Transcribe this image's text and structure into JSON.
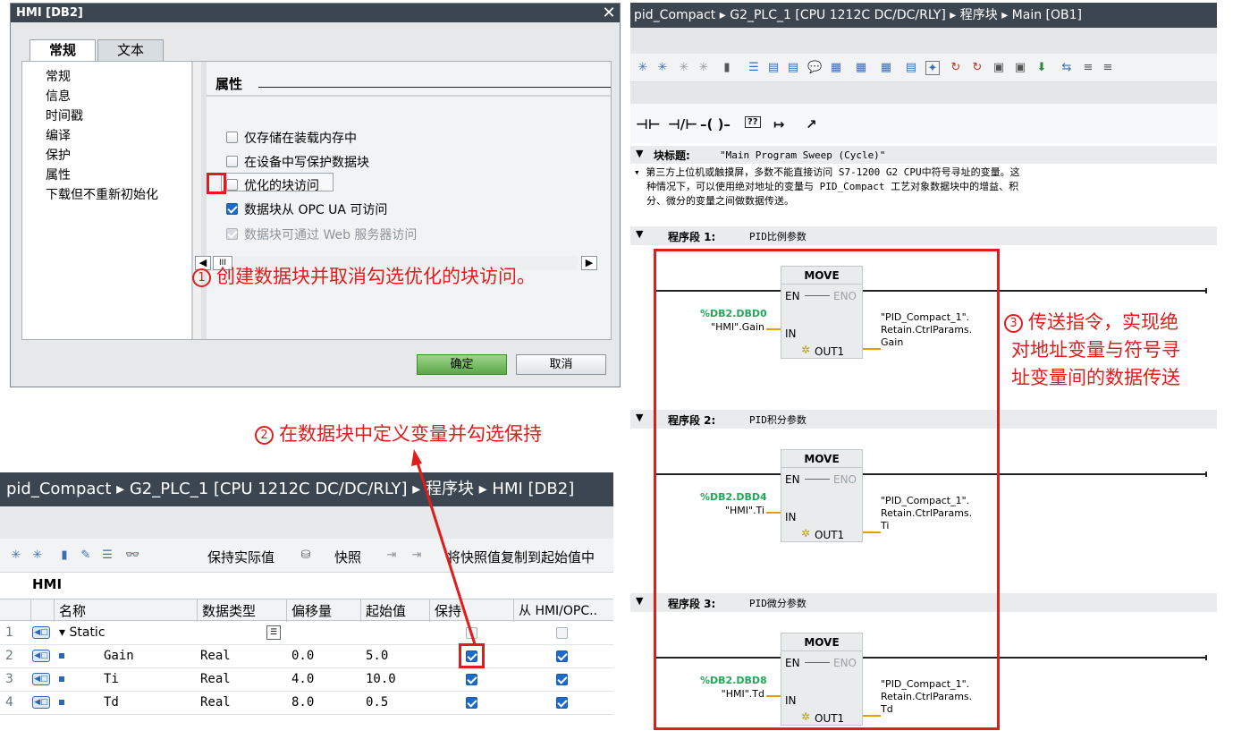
{
  "dialog": {
    "title": "HMI [DB2]",
    "close_glyph": "✕",
    "tabs": [
      "常规",
      "文本"
    ],
    "nav_items": [
      "常规",
      "信息",
      "时间戳",
      "编译",
      "保护",
      "属性",
      "下载但不重新初始化"
    ],
    "section_title": "属性",
    "options": [
      {
        "label": "仅存储在装载内存中",
        "checked": false,
        "enabled": true
      },
      {
        "label": "在设备中写保护数据块",
        "checked": false,
        "enabled": true
      },
      {
        "label": "优化的块访问",
        "checked": false,
        "enabled": true
      },
      {
        "label": "数据块从 OPC UA 可访问",
        "checked": true,
        "enabled": true
      },
      {
        "label": "数据块可通过 Web 服务器访问",
        "checked": true,
        "enabled": false
      }
    ],
    "scroll_thumb_glyph": "III",
    "ok_label": "确定",
    "cancel_label": "取消"
  },
  "annotations": {
    "note1_num": "1",
    "note1": "创建数据块并取消勾选优化的块访问。",
    "note2_num": "2",
    "note2": "在数据块中定义变量并勾选保持",
    "note3_num": "3",
    "note3_lines": [
      "传送指令，实现绝",
      "对地址变量与符号寻",
      "址变量间的数据传送"
    ],
    "accent_color": "#e21b1b"
  },
  "db_table": {
    "breadcrumb": "pid_Compact ▸ G2_PLC_1 [CPU 1212C DC/DC/RLY] ▸ 程序块 ▸ HMI [DB2]",
    "toolbar": {
      "keep_actual": "保持实际值",
      "snapshot": "快照",
      "copy_snapshot": "将快照值复制到起始值中"
    },
    "block_name": "HMI",
    "columns": [
      "名称",
      "数据类型",
      "偏移量",
      "起始值",
      "保持",
      "从 HMI/OPC.."
    ],
    "rows": [
      {
        "num": "1",
        "name": "Static",
        "type": "",
        "offset": "",
        "start": "",
        "retain": false,
        "hmi": false,
        "is_group": true
      },
      {
        "num": "2",
        "name": "Gain",
        "type": "Real",
        "offset": "0.0",
        "start": "5.0",
        "retain": true,
        "hmi": true
      },
      {
        "num": "3",
        "name": "Ti",
        "type": "Real",
        "offset": "4.0",
        "start": "10.0",
        "retain": true,
        "hmi": true
      },
      {
        "num": "4",
        "name": "Td",
        "type": "Real",
        "offset": "8.0",
        "start": "0.5",
        "retain": true,
        "hmi": true
      }
    ]
  },
  "lad": {
    "breadcrumb": "pid_Compact ▸ G2_PLC_1 [CPU 1212C DC/DC/RLY] ▸ 程序块 ▸ Main [OB1]",
    "favorites": [
      "⊣⊢",
      "⊣/⊢",
      "–( )–",
      "??",
      "↦",
      "↗"
    ],
    "block_title_label": "块标题:",
    "block_title": "\"Main Program Sweep (Cycle)\"",
    "block_comment": [
      "第三方上位机或触摸屏，多数不能直接访问 S7-1200 G2 CPU中符号寻址的变量。这",
      "种情况下，可以使用绝对地址的变量与 PID_Compact 工艺对象数据块中的增益、积",
      "分、微分的变量之间做数据传送。"
    ],
    "networks": [
      {
        "label": "程序段 1:",
        "comment": "PID比例参数",
        "instr": "MOVE",
        "addr": "%DB2.DBD0",
        "in_name": "\"HMI\".Gain",
        "out_lines": [
          "\"PID_Compact_1\".",
          "Retain.CtrlParams.",
          "Gain"
        ]
      },
      {
        "label": "程序段 2:",
        "comment": "PID积分参数",
        "instr": "MOVE",
        "addr": "%DB2.DBD4",
        "in_name": "\"HMI\".Ti",
        "out_lines": [
          "\"PID_Compact_1\".",
          "Retain.CtrlParams.",
          "Ti"
        ]
      },
      {
        "label": "程序段 3:",
        "comment": "PID微分参数",
        "instr": "MOVE",
        "addr": "%DB2.DBD8",
        "in_name": "\"HMI\".Td",
        "out_lines": [
          "\"PID_Compact_1\".",
          "Retain.CtrlParams.",
          "Td"
        ]
      }
    ],
    "pins": {
      "en": "EN",
      "eno": "ENO",
      "in": "IN",
      "out": "OUT1"
    }
  }
}
